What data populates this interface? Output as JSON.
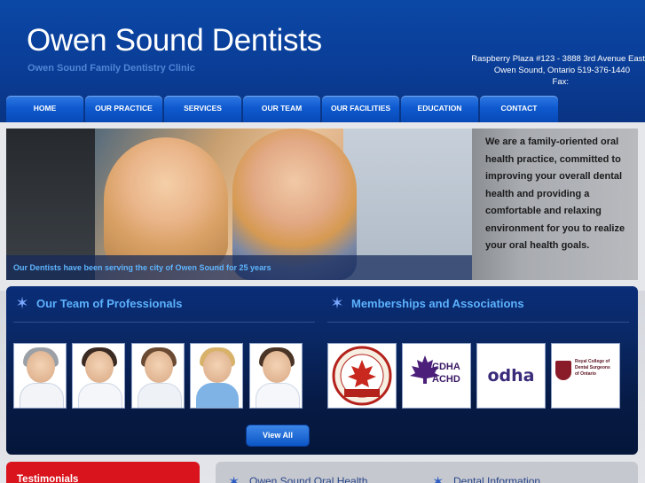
{
  "header": {
    "site_title": "Owen Sound Dentists",
    "subtitle": "Owen Sound Family Dentistry Clinic",
    "address_line1": "Raspberry Plaza #123 - 3888 3rd Avenue East",
    "address_line2": "Owen Sound, Ontario   519-376-1440",
    "address_line3": "Fax:"
  },
  "nav": {
    "items": [
      {
        "label": "HOME"
      },
      {
        "label": "OUR PRACTICE"
      },
      {
        "label": "SERVICES"
      },
      {
        "label": "OUR TEAM"
      },
      {
        "label": "OUR FACILITIES"
      },
      {
        "label": "EDUCATION"
      },
      {
        "label": "CONTACT"
      }
    ]
  },
  "hero": {
    "caption": "Our Dentists have been serving the city of Owen Sound for 25 years",
    "intro_text": "We are a family-oriented oral health practice, committed to improving your overall dental health and providing a comfortable and relaxing environment for you to realize your oral health goals."
  },
  "team": {
    "title": "Our Team of Professionals",
    "view_all_label": "View All"
  },
  "memberships": {
    "title": "Memberships and Associations",
    "logos": {
      "cda": "CANADIAN DENTAL ASSOCIATION",
      "cda_member": "MEMBER",
      "cdha_1": "CDHA",
      "cdha_2": "ACHD",
      "odha": "odha",
      "rcds_1": "Royal College of",
      "rcds_2": "Dental Surgeons",
      "rcds_3": "of Ontario"
    }
  },
  "bottom": {
    "testimonials_title": "Testimonials",
    "oral_health_title": "Owen Sound Oral Health",
    "dental_info_title": "Dental Information"
  },
  "colors": {
    "header_blue": "#0a3d97",
    "nav_blue": "#0f5ad0",
    "accent_light_blue": "#5cb2ff",
    "testimonials_red": "#d9141c"
  }
}
